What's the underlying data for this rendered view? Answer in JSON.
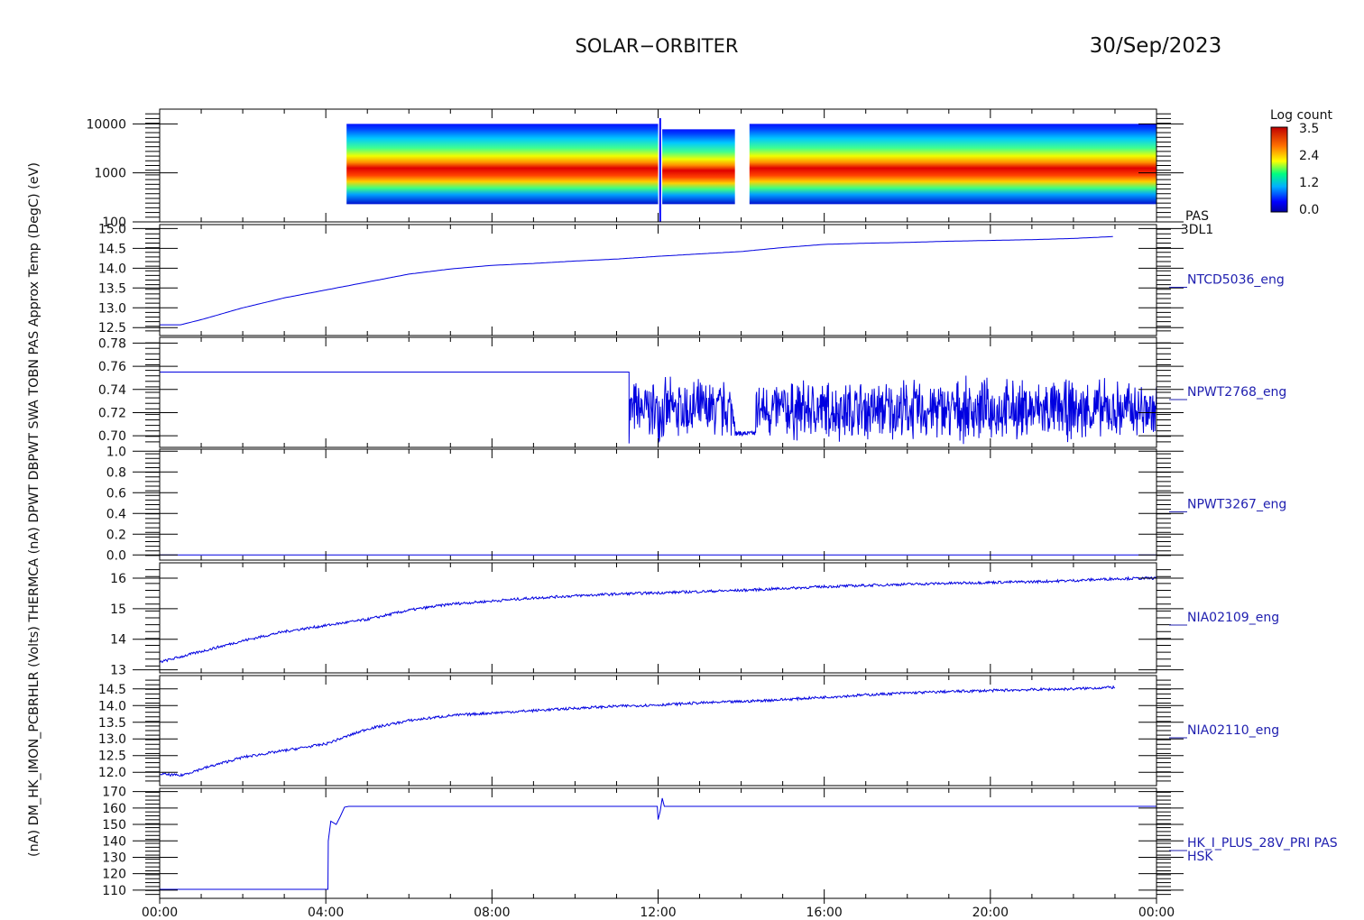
{
  "header": {
    "title": "SOLAR−ORBITER",
    "date": "30/Sep/2023"
  },
  "x_axis": {
    "ticks": [
      "00:00",
      "04:00",
      "08:00",
      "12:00",
      "16:00",
      "20:00",
      "00:00"
    ]
  },
  "colorbar": {
    "title": "Log count",
    "ticks": [
      "3.5",
      "2.4",
      "1.2",
      "0.0"
    ]
  },
  "left_axis_text": "(nA)  DM_HK_IMON_PCBRHLR (Volts)  THERMCA (nA)  DPWT  DBPWT  SWA  TOBN  PAS  Approx Temp (DegC)  (eV)",
  "colors": {
    "trace": "#0000e0",
    "axis": "#000000",
    "label": "#2020b0"
  },
  "chart_data": [
    {
      "type": "heatmap",
      "id": "pas-3dl1",
      "right_label": [
        "PAS",
        "3DL1"
      ],
      "ylabel": "(eV)",
      "y_scale": "log",
      "ylim": [
        100,
        20000
      ],
      "y_ticks": [
        "10000",
        "1000",
        "100"
      ],
      "data_intervals_hours": [
        [
          4.5,
          12.0
        ],
        [
          12.1,
          13.85
        ],
        [
          14.2,
          24.0
        ]
      ],
      "peak_energy_ev": 900,
      "colorbar_range": [
        0.0,
        3.5
      ]
    },
    {
      "type": "line",
      "id": "NTCD5036_eng",
      "right_label": [
        "NTCD5036_eng"
      ],
      "ylim": [
        12.3,
        15.1
      ],
      "y_ticks": [
        "15.0",
        "14.5",
        "14.0",
        "13.5",
        "13.0",
        "12.5"
      ],
      "x": [
        0,
        0.5,
        1,
        2,
        3,
        4,
        5,
        6,
        7,
        8,
        9,
        10,
        11,
        12,
        13,
        14,
        15,
        16,
        17,
        18,
        19,
        20,
        21,
        22,
        23,
        24
      ],
      "values": [
        12.57,
        12.57,
        12.7,
        13.0,
        13.25,
        13.45,
        13.65,
        13.85,
        13.98,
        14.07,
        14.12,
        14.18,
        14.23,
        14.3,
        14.36,
        14.42,
        14.52,
        14.6,
        14.63,
        14.65,
        14.68,
        14.7,
        14.72,
        14.75,
        14.8
      ]
    },
    {
      "type": "line",
      "id": "NPWT2768_eng",
      "right_label": [
        "NPWT2768_eng"
      ],
      "ylim": [
        0.69,
        0.785
      ],
      "y_ticks": [
        "0.78",
        "0.76",
        "0.74",
        "0.72",
        "0.70"
      ],
      "flat_until_hour": 11.3,
      "flat_value": 0.755,
      "noisy_center": 0.722,
      "noisy_amplitude": 0.03,
      "dip": {
        "from_hour": 13.85,
        "to_hour": 14.35,
        "value": 0.702
      }
    },
    {
      "type": "line",
      "id": "NPWT3267_eng",
      "right_label": [
        "NPWT3267_eng"
      ],
      "ylim": [
        -0.05,
        1.02
      ],
      "y_ticks": [
        "1.0",
        "0.8",
        "0.6",
        "0.4",
        "0.2",
        "0.0"
      ],
      "x": [
        0,
        24
      ],
      "values": [
        0.0,
        0.0
      ]
    },
    {
      "type": "line",
      "id": "NIA02109_eng",
      "right_label": [
        "NIA02109_eng"
      ],
      "ylim": [
        12.9,
        16.5
      ],
      "y_ticks": [
        "16",
        "15",
        "14",
        "13"
      ],
      "x": [
        0,
        1,
        2,
        3,
        4,
        5,
        6,
        7,
        8,
        9,
        10,
        11,
        12,
        13,
        14,
        15,
        16,
        17,
        18,
        19,
        20,
        21,
        22,
        23,
        24
      ],
      "values": [
        13.25,
        13.6,
        13.95,
        14.25,
        14.45,
        14.65,
        14.95,
        15.15,
        15.25,
        15.35,
        15.42,
        15.48,
        15.52,
        15.56,
        15.6,
        15.66,
        15.72,
        15.76,
        15.8,
        15.83,
        15.86,
        15.88,
        15.92,
        15.98,
        16.0
      ]
    },
    {
      "type": "line",
      "id": "NIA02110_eng",
      "right_label": [
        "NIA02110_eng"
      ],
      "ylim": [
        11.6,
        14.9
      ],
      "y_ticks": [
        "14.5",
        "14.0",
        "13.5",
        "13.0",
        "12.5",
        "12.0"
      ],
      "x": [
        0,
        0.5,
        1,
        2,
        3,
        4,
        5,
        6,
        7,
        8,
        9,
        10,
        11,
        12,
        13,
        14,
        15,
        16,
        17,
        18,
        19,
        20,
        21,
        22,
        23,
        24
      ],
      "values": [
        11.95,
        11.9,
        12.1,
        12.45,
        12.65,
        12.85,
        13.3,
        13.55,
        13.7,
        13.78,
        13.85,
        13.92,
        13.98,
        14.02,
        14.08,
        14.12,
        14.18,
        14.25,
        14.32,
        14.38,
        14.42,
        14.45,
        14.48,
        14.5,
        14.55
      ]
    },
    {
      "type": "line",
      "id": "HK_I_PLUS_28V_PRI",
      "right_label": [
        "HK_I_PLUS_28V_PRI PAS",
        "HSK"
      ],
      "ylabel": "(nA)",
      "ylim": [
        105,
        172
      ],
      "y_ticks": [
        "170",
        "160",
        "150",
        "140",
        "130",
        "120",
        "110"
      ],
      "x": [
        0,
        4.05,
        4.06,
        4.12,
        4.25,
        4.35,
        4.45,
        4.55,
        11.98,
        12.0,
        12.05,
        12.1,
        12.15,
        24
      ],
      "values": [
        110.5,
        110.5,
        140,
        152,
        150,
        155,
        160.5,
        161,
        161,
        153,
        158,
        166,
        161,
        161
      ]
    }
  ]
}
